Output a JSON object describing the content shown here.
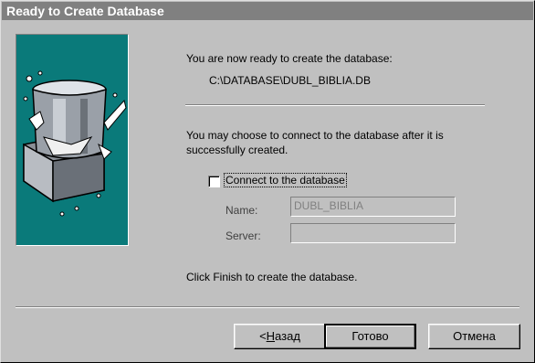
{
  "window": {
    "title": "Ready to Create Database"
  },
  "main": {
    "ready_text": "You are now ready to create the database:",
    "db_path": "C:\\DATABASE\\DUBL_BIBLIA.DB",
    "connect_text_line1": "You may choose to connect to the database after it is",
    "connect_text_line2": "successfully created.",
    "connect_checkbox": {
      "label": "Connect to the database",
      "checked": false
    },
    "name_label": "Name:",
    "name_value": "DUBL_BIBLIA",
    "server_label": "Server:",
    "server_value": "",
    "finish_text": "Click Finish to create the database."
  },
  "buttons": {
    "back_arrow": "<",
    "back_mnemonic": "Н",
    "back_rest": "азад",
    "finish": "Готово",
    "cancel": "Отмена"
  },
  "colors": {
    "titlebar": "#808080",
    "art_background": "#0a7a7a",
    "face": "#c0c0c0"
  },
  "icons": {
    "art": "database-barrel-art"
  }
}
